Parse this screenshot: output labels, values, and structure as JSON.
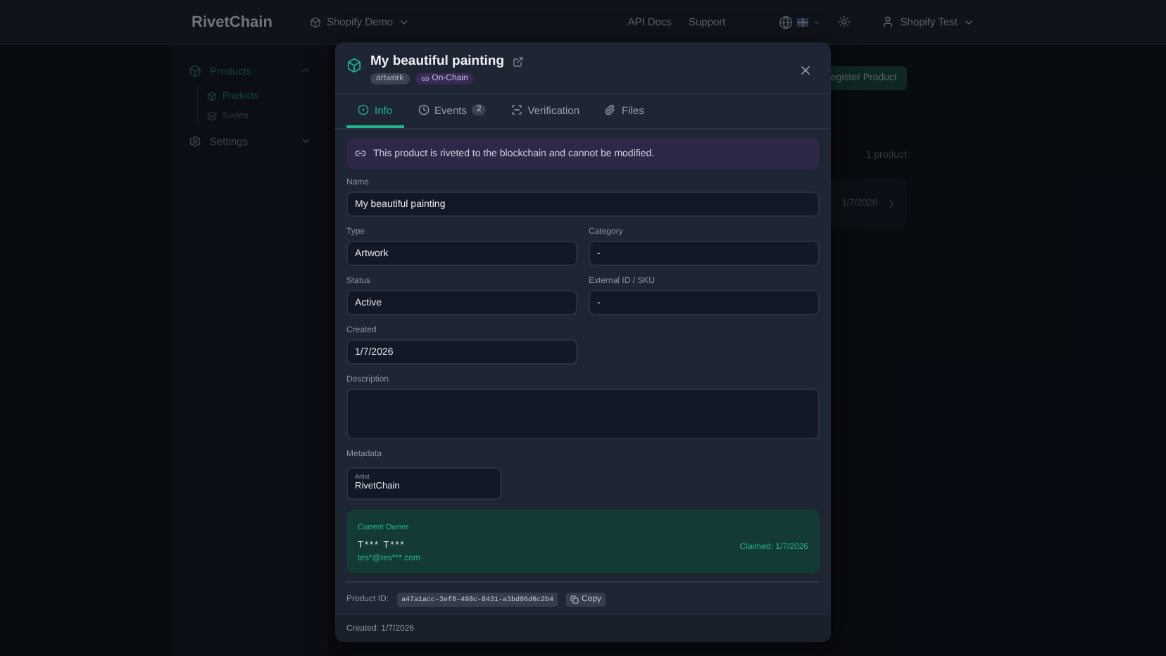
{
  "header": {
    "brand": "RivetChain",
    "workspace": "Shopify Demo",
    "links": [
      "API Docs",
      "Support"
    ],
    "user": "Shopify Test"
  },
  "sidebar": {
    "items": [
      {
        "label": "Products",
        "expanded": true,
        "children": [
          {
            "label": "Products",
            "selected": true
          },
          {
            "label": "Series",
            "selected": false
          }
        ]
      },
      {
        "label": "Settings",
        "expanded": false
      }
    ]
  },
  "main": {
    "register_button": "egister Product",
    "count": "1 product",
    "row_date": "1/7/2026"
  },
  "modal": {
    "title": "My beautiful painting",
    "tags": [
      {
        "label": "artwork",
        "kind": "type"
      },
      {
        "label": "On-Chain",
        "kind": "chain"
      }
    ],
    "tabs": [
      {
        "label": "Info",
        "selected": true
      },
      {
        "label": "Events",
        "selected": false,
        "badge": "2"
      },
      {
        "label": "Verification",
        "selected": false
      },
      {
        "label": "Files",
        "selected": false
      }
    ],
    "notice": "This product is riveted to the blockchain and cannot be modified.",
    "fields": [
      {
        "label": "Name",
        "value": "My beautiful painting",
        "kind": "full"
      },
      {
        "label": "Type",
        "value": "Artwork",
        "kind": "half"
      },
      {
        "label": "Category",
        "value": "-",
        "kind": "half"
      },
      {
        "label": "Status",
        "value": "Active",
        "kind": "half"
      },
      {
        "label": "External ID / SKU",
        "value": "-",
        "kind": "half"
      },
      {
        "label": "Created",
        "value": "1/7/2026",
        "kind": "half"
      },
      {
        "label": "Description",
        "kind": "area"
      }
    ],
    "metadata_label": "Metadata",
    "metadata": [
      {
        "key": "Artist",
        "value": "RivetChain"
      }
    ],
    "owner": {
      "heading": "Current Owner",
      "name": "T*** T***",
      "email": "tes*@tes***.com",
      "claimed": "Claimed: 1/7/2026"
    },
    "product_id": {
      "label": "Product ID:",
      "value": "a47a1acc-3ef8-498c-8431-a3bd06d6c2b4",
      "copy": "Copy"
    },
    "footer": "Created: 1/7/2026"
  }
}
